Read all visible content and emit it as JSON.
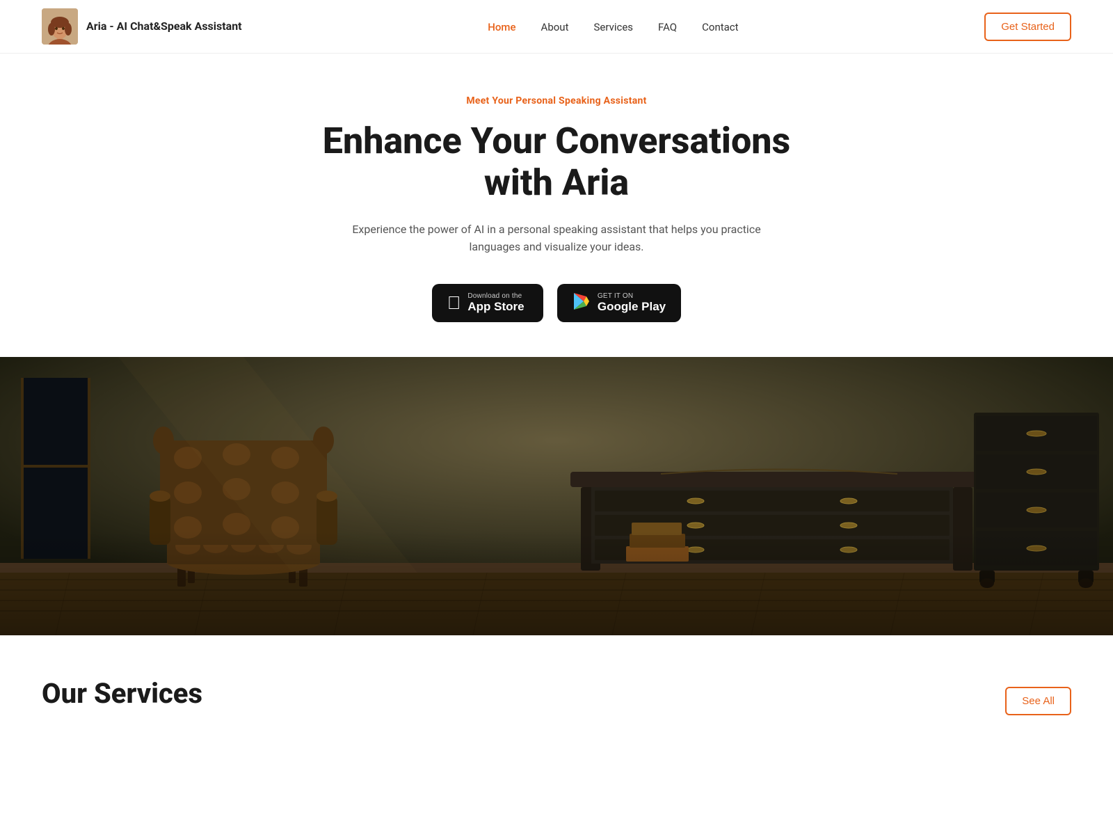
{
  "brand": {
    "name": "Aria - AI Chat&Speak Assistant"
  },
  "navbar": {
    "links": [
      {
        "label": "Home",
        "active": true
      },
      {
        "label": "About",
        "active": false
      },
      {
        "label": "Services",
        "active": false
      },
      {
        "label": "FAQ",
        "active": false
      },
      {
        "label": "Contact",
        "active": false
      }
    ],
    "cta_label": "Get Started"
  },
  "hero": {
    "subtitle": "Meet Your Personal Speaking Assistant",
    "title": "Enhance Your Conversations with Aria",
    "description": "Experience the power of AI in a personal speaking assistant that helps you practice languages and visualize your ideas.",
    "app_store_label_small": "Download on the",
    "app_store_label_large": "App Store",
    "google_play_label_small": "GET IT ON",
    "google_play_label_large": "Google Play"
  },
  "services": {
    "title": "Our Services",
    "see_all_label": "See All"
  },
  "colors": {
    "accent": "#e8621a",
    "text_primary": "#1a1a1a",
    "text_secondary": "#555555"
  }
}
